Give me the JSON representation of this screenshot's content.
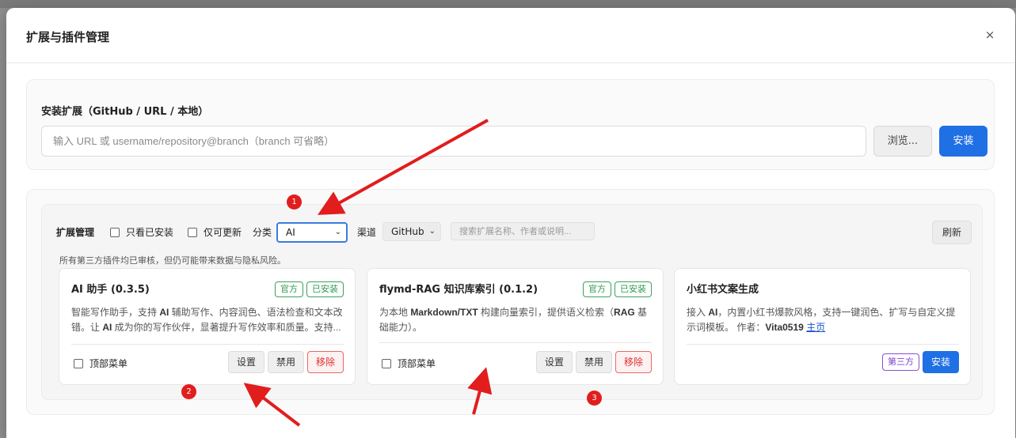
{
  "modal": {
    "title": "扩展与插件管理",
    "close_label": "×"
  },
  "install": {
    "title": "安装扩展（GitHub / URL / 本地）",
    "placeholder": "输入 URL 或 username/repository@branch（branch 可省略）",
    "browse_label": "浏览...",
    "install_label": "安装"
  },
  "manage": {
    "title": "扩展管理",
    "only_installed_label": "只看已安装",
    "updatable_label": "仅可更新",
    "category_label": "分类",
    "category_value": "AI",
    "channel_label": "渠道",
    "channel_value": "GitHub",
    "search_placeholder": "搜索扩展名称、作者或说明...",
    "refresh_label": "刷新",
    "notice": "所有第三方插件均已审核，但仍可能带来数据与隐私风险。"
  },
  "cards": [
    {
      "title": "AI 助手 (0.3.5)",
      "badges": [
        "官方",
        "已安装"
      ],
      "desc_parts": [
        "智能写作助手，支持 ",
        "AI",
        " 辅助写作、内容润色、语法检查和文本改错。让 ",
        "AI",
        " 成为你的写作伙伴，显著提升写作效率和质量。支持..."
      ],
      "top_menu_label": "顶部菜单",
      "settings_label": "设置",
      "disable_label": "禁用",
      "remove_label": "移除"
    },
    {
      "title": "flymd-RAG 知识库索引 (0.1.2)",
      "badges": [
        "官方",
        "已安装"
      ],
      "desc_parts": [
        "为本地 ",
        "Markdown/TXT",
        " 构建向量索引，提供语义检索（",
        "RAG",
        " 基础能力）。"
      ],
      "top_menu_label": "顶部菜单",
      "settings_label": "设置",
      "disable_label": "禁用",
      "remove_label": "移除"
    },
    {
      "title": "小红书文案生成",
      "desc_parts": [
        "接入 ",
        "AI",
        "，内置小红书爆款风格，支持一键润色、扩写与自定义提示词模板。 作者：",
        "Vita0519",
        " ",
        "主页"
      ],
      "third_party_label": "第三方",
      "install_label": "安装"
    }
  ],
  "markers": [
    "1",
    "2",
    "3"
  ],
  "colors": {
    "primary": "#1f6fe5",
    "official_green": "#2f9a50",
    "danger": "#d33333",
    "third_party_purple": "#7c3fd0",
    "annotation_red": "#e11d1d"
  }
}
